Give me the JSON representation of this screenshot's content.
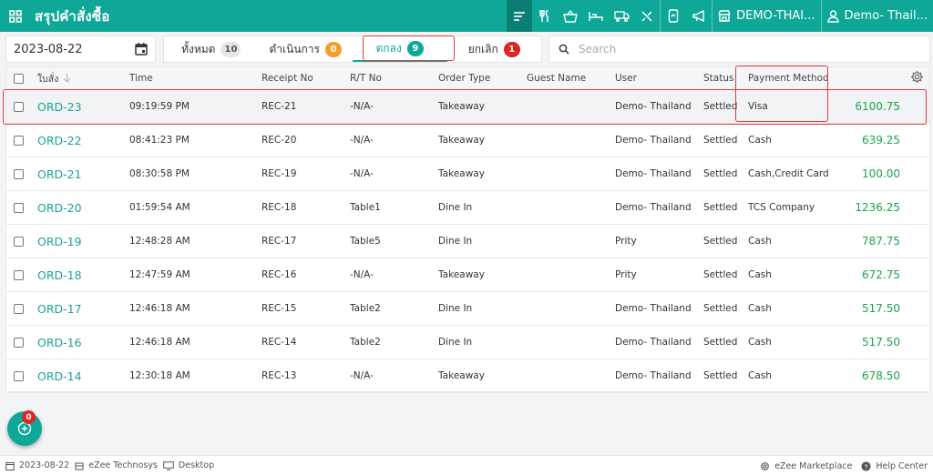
{
  "header": {
    "title": "สรุปคำสั่งซื้อ",
    "outlet": "DEMO-THAI...",
    "user": "Demo- Thail..."
  },
  "filters": {
    "date": "2023-08-22",
    "tabs": [
      {
        "label": "ทั้งหมด",
        "count": "10"
      },
      {
        "label": "ดำเนินการ",
        "count": "0"
      },
      {
        "label": "ตกลง",
        "count": "9"
      },
      {
        "label": "ยกเลิก",
        "count": "1"
      }
    ],
    "search_placeholder": "Search"
  },
  "table": {
    "headers": {
      "order": "ใบสั่ง",
      "time": "Time",
      "receipt": "Receipt No",
      "rt": "R/T No",
      "order_type": "Order Type",
      "guest": "Guest Name",
      "user": "User",
      "status": "Status",
      "payment": "Payment Method"
    },
    "rows": [
      {
        "order": "ORD-23",
        "time": "09:19:59 PM",
        "receipt": "REC-21",
        "rt": "-N/A-",
        "type": "Takeaway",
        "guest": "",
        "user": "Demo- Thailand",
        "status": "Settled",
        "payment": "Visa",
        "amount": "6100.75"
      },
      {
        "order": "ORD-22",
        "time": "08:41:23 PM",
        "receipt": "REC-20",
        "rt": "-N/A-",
        "type": "Takeaway",
        "guest": "",
        "user": "Demo- Thailand",
        "status": "Settled",
        "payment": "Cash",
        "amount": "639.25"
      },
      {
        "order": "ORD-21",
        "time": "08:30:58 PM",
        "receipt": "REC-19",
        "rt": "-N/A-",
        "type": "Takeaway",
        "guest": "",
        "user": "Demo- Thailand",
        "status": "Settled",
        "payment": "Cash,Credit Card",
        "amount": "100.00"
      },
      {
        "order": "ORD-20",
        "time": "01:59:54 AM",
        "receipt": "REC-18",
        "rt": "Table1",
        "type": "Dine In",
        "guest": "",
        "user": "Demo- Thailand",
        "status": "Settled",
        "payment": "TCS Company",
        "amount": "1236.25"
      },
      {
        "order": "ORD-19",
        "time": "12:48:28 AM",
        "receipt": "REC-17",
        "rt": "Table5",
        "type": "Dine In",
        "guest": "",
        "user": "Prity",
        "status": "Settled",
        "payment": "Cash",
        "amount": "787.75"
      },
      {
        "order": "ORD-18",
        "time": "12:47:59 AM",
        "receipt": "REC-16",
        "rt": "-N/A-",
        "type": "Takeaway",
        "guest": "",
        "user": "Prity",
        "status": "Settled",
        "payment": "Cash",
        "amount": "672.75"
      },
      {
        "order": "ORD-17",
        "time": "12:46:18 AM",
        "receipt": "REC-15",
        "rt": "Table2",
        "type": "Dine In",
        "guest": "",
        "user": "Demo- Thailand",
        "status": "Settled",
        "payment": "Cash",
        "amount": "517.50"
      },
      {
        "order": "ORD-16",
        "time": "12:46:18 AM",
        "receipt": "REC-14",
        "rt": "Table2",
        "type": "Dine In",
        "guest": "",
        "user": "Demo- Thailand",
        "status": "Settled",
        "payment": "Cash",
        "amount": "517.50"
      },
      {
        "order": "ORD-14",
        "time": "12:30:18 AM",
        "receipt": "REC-13",
        "rt": "-N/A-",
        "type": "Takeaway",
        "guest": "",
        "user": "Demo- Thailand",
        "status": "Settled",
        "payment": "Cash",
        "amount": "678.50"
      }
    ]
  },
  "fab": {
    "count": "0"
  },
  "footer": {
    "date": "2023-08-22",
    "company": "eZee Technosys",
    "device": "Desktop",
    "marketplace": "eZee Marketplace",
    "help": "Help Center"
  },
  "colors": {
    "brand": "#0fa898",
    "badge_all": "#e3e5e8",
    "badge_pending": "#f59e2c",
    "badge_ok": "#0fa898",
    "badge_cancel": "#e02424",
    "amount": "#1ba44a",
    "highlight_outline": "#e23b3b"
  }
}
